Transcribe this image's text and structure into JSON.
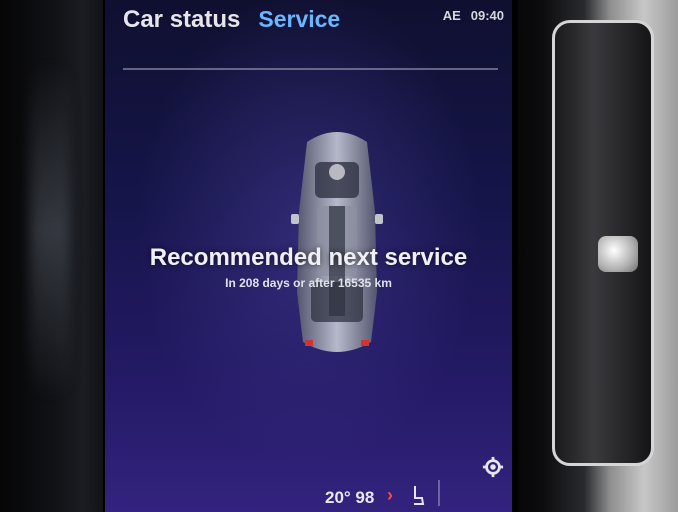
{
  "header": {
    "tab_car_status": "Car status",
    "tab_service": "Service",
    "status_region": "AE",
    "status_time": "09:40"
  },
  "service": {
    "title": "Recommended next service",
    "detail": "In 208 days or after 16535 km"
  },
  "bottom_bar": {
    "temperature": "20° 98"
  },
  "colors": {
    "accent": "#6ab7ff",
    "screen_top": "#0f1030",
    "screen_bottom": "#33237e",
    "alert": "#ff4a4a"
  },
  "icons": [
    "car-topview-icon",
    "chevron-right-icon",
    "seat-heat-icon",
    "gear-icon"
  ]
}
